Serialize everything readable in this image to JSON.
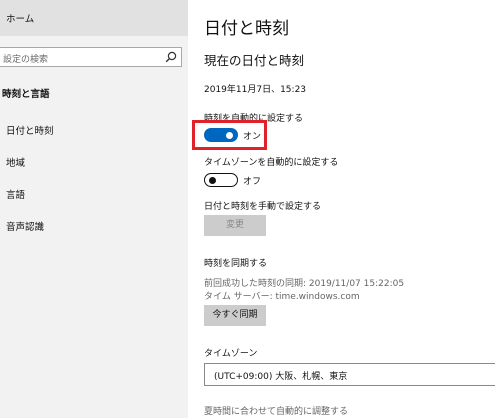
{
  "sidebar": {
    "home_label": "ホーム",
    "search_placeholder": "設定の検索",
    "section_title": "時刻と言語",
    "items": [
      {
        "label": "日付と時刻"
      },
      {
        "label": "地域"
      },
      {
        "label": "言語"
      },
      {
        "label": "音声認識"
      }
    ]
  },
  "main": {
    "title": "日付と時刻",
    "subtitle": "現在の日付と時刻",
    "current_datetime": "2019年11月7日、15:23",
    "auto_time": {
      "label": "時刻を自動的に設定する",
      "state": "オン"
    },
    "auto_timezone": {
      "label": "タイムゾーンを自動的に設定する",
      "state": "オフ"
    },
    "manual": {
      "label": "日付と時刻を手動で設定する",
      "button": "変更"
    },
    "sync": {
      "title": "時刻を同期する",
      "last_sync": "前回成功した時刻の同期: 2019/11/07 15:22:05",
      "server": "タイム サーバー: time.windows.com",
      "button": "今すぐ同期"
    },
    "timezone": {
      "label": "タイムゾーン",
      "value": "(UTC+09:00) 大阪、札幌、東京"
    },
    "dst_label": "夏時間に合わせて自動的に調整する"
  },
  "colors": {
    "accent": "#0067c0",
    "highlight": "#e0212b"
  }
}
